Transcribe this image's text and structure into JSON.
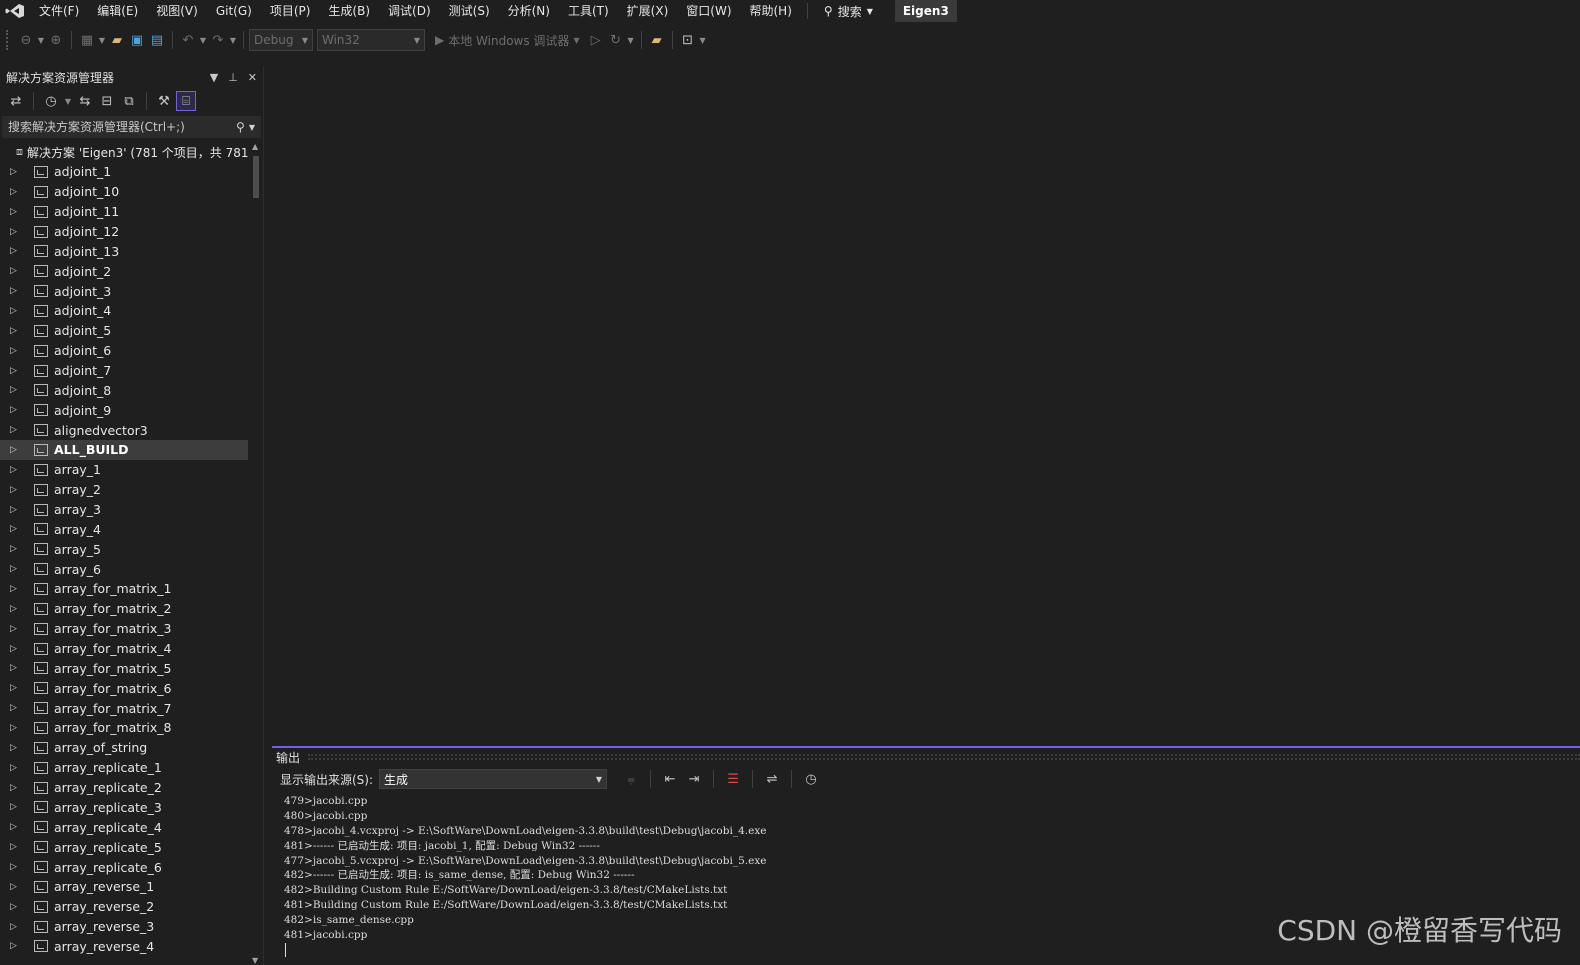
{
  "menubar": {
    "items": [
      "文件(F)",
      "编辑(E)",
      "视图(V)",
      "Git(G)",
      "项目(P)",
      "生成(B)",
      "调试(D)",
      "测试(S)",
      "分析(N)",
      "工具(T)",
      "扩展(X)",
      "窗口(W)",
      "帮助(H)"
    ],
    "search_label": "搜索",
    "solution_name": "Eigen3"
  },
  "toolbar": {
    "config": "Debug",
    "platform": "Win32",
    "run_label": "本地 Windows 调试器"
  },
  "solution_explorer": {
    "title": "解决方案资源管理器",
    "search_placeholder": "搜索解决方案资源管理器(Ctrl+;)",
    "root_label": "解决方案 'Eigen3' (781 个项目，共 781",
    "projects": [
      "adjoint_1",
      "adjoint_10",
      "adjoint_11",
      "adjoint_12",
      "adjoint_13",
      "adjoint_2",
      "adjoint_3",
      "adjoint_4",
      "adjoint_5",
      "adjoint_6",
      "adjoint_7",
      "adjoint_8",
      "adjoint_9",
      "alignedvector3",
      "ALL_BUILD",
      "array_1",
      "array_2",
      "array_3",
      "array_4",
      "array_5",
      "array_6",
      "array_for_matrix_1",
      "array_for_matrix_2",
      "array_for_matrix_3",
      "array_for_matrix_4",
      "array_for_matrix_5",
      "array_for_matrix_6",
      "array_for_matrix_7",
      "array_for_matrix_8",
      "array_of_string",
      "array_replicate_1",
      "array_replicate_2",
      "array_replicate_3",
      "array_replicate_4",
      "array_replicate_5",
      "array_replicate_6",
      "array_reverse_1",
      "array_reverse_2",
      "array_reverse_3",
      "array_reverse_4"
    ],
    "selected_project": "ALL_BUILD"
  },
  "output": {
    "title": "输出",
    "source_label": "显示输出来源(S):",
    "source_value": "生成",
    "lines": [
      "479>jacobi.cpp",
      "480>jacobi.cpp",
      "478>jacobi_4.vcxproj -> E:\\SoftWare\\DownLoad\\eigen-3.3.8\\build\\test\\Debug\\jacobi_4.exe",
      "481>------ 已启动生成: 项目: jacobi_1, 配置: Debug Win32 ------",
      "477>jacobi_5.vcxproj -> E:\\SoftWare\\DownLoad\\eigen-3.3.8\\build\\test\\Debug\\jacobi_5.exe",
      "482>------ 已启动生成: 项目: is_same_dense, 配置: Debug Win32 ------",
      "482>Building Custom Rule E:/SoftWare/DownLoad/eigen-3.3.8/test/CMakeLists.txt",
      "481>Building Custom Rule E:/SoftWare/DownLoad/eigen-3.3.8/test/CMakeLists.txt",
      "482>is_same_dense.cpp",
      "481>jacobi.cpp"
    ]
  },
  "watermark": "CSDN @橙留香写代码",
  "colors": {
    "accent": "#7160e8",
    "background": "#1f1f1f",
    "selected_row": "#3d3d3d"
  }
}
